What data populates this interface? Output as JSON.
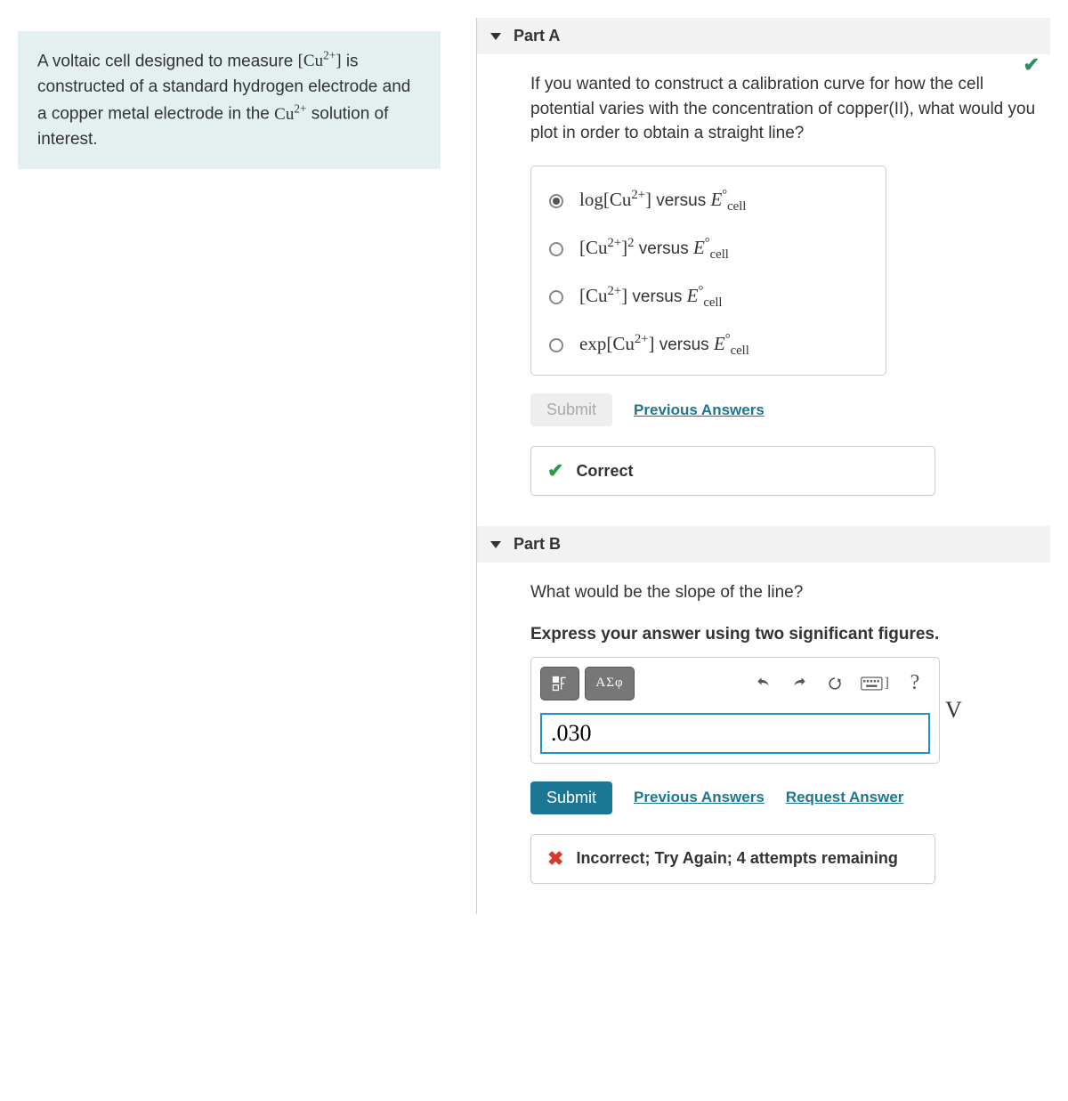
{
  "intro": {
    "prefix": "A voltaic cell designed to measure ",
    "measure_expr": "[Cu²⁺]",
    "mid": " is constructed of a standard hydrogen electrode and a copper metal electrode in the ",
    "ion": "Cu²⁺",
    "suffix": " solution of interest."
  },
  "partA": {
    "title": "Part A",
    "status": "correct",
    "question": "If you wanted to construct a calibration curve for how the cell potential varies with the concentration of copper(II), what would you plot in order to obtain a straight line?",
    "options": [
      {
        "label_html": "log[Cu²⁺] versus E°_cell",
        "selected": true
      },
      {
        "label_html": "[Cu²⁺]² versus E°_cell",
        "selected": false
      },
      {
        "label_html": "[Cu²⁺] versus E°_cell",
        "selected": false
      },
      {
        "label_html": "exp[Cu²⁺] versus E°_cell",
        "selected": false
      }
    ],
    "submit_label": "Submit",
    "prev_label": "Previous Answers",
    "feedback": "Correct"
  },
  "partB": {
    "title": "Part B",
    "question": "What would be the slope of the line?",
    "hint": "Express your answer using two significant figures.",
    "toolbar": {
      "templates": "template",
      "greek": "ΑΣφ",
      "undo": "undo",
      "redo": "redo",
      "reset": "reset",
      "keyboard": "keyboard",
      "help": "?"
    },
    "answer_value": ".030",
    "unit": "V",
    "submit_label": "Submit",
    "prev_label": "Previous Answers",
    "request_label": "Request Answer",
    "feedback": "Incorrect; Try Again; 4 attempts remaining"
  }
}
